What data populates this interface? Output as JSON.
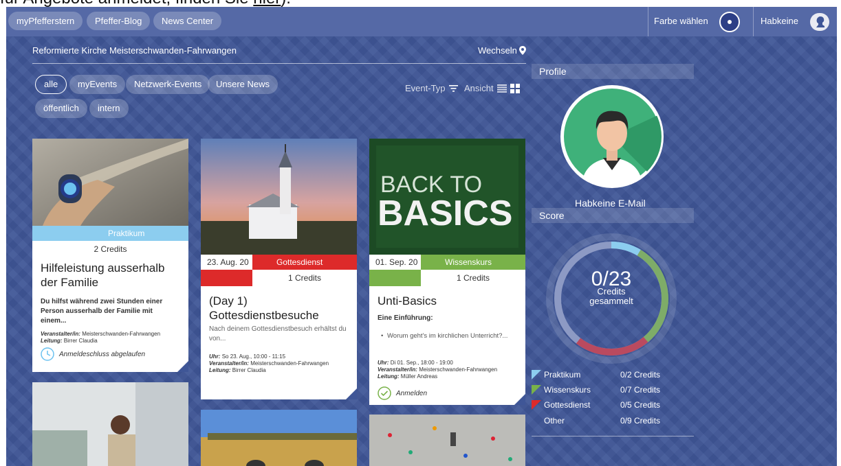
{
  "top_snippet": {
    "text": "für Angebote anmeldet, finden Sie ",
    "link": "hier",
    "end": ")."
  },
  "topbar": {
    "nav": [
      "myPfefferstern",
      "Pfeffer-Blog",
      "News Center"
    ],
    "color_label": "Farbe wählen",
    "user_name": "Habkeine"
  },
  "org": {
    "name": "Reformierte Kirche Meisterschwanden-Fahrwangen",
    "switch_label": "Wechseln"
  },
  "filters": {
    "row1": [
      "alle",
      "myEvents",
      "Netzwerk-Events",
      "Unsere News"
    ],
    "row2": [
      "öffentlich",
      "intern"
    ],
    "event_type_label": "Event-Typ",
    "view_label": "Ansicht"
  },
  "cards": [
    {
      "category": "Praktikum",
      "category_color": "#8ccdef",
      "credits": "2 Credits",
      "title": "Hilfeleistung ausserhalb der Familie",
      "desc": "Du hilfst während zwei Stunden einer Person ausserhalb der Familie mit einem...",
      "organizer_label": "Veranstalter/in:",
      "organizer": "Meisterschwanden-Fahrwangen",
      "leader_label": "Leitung:",
      "leader": "Birrer Claudia",
      "action": "Anmeldeschluss abgelaufen"
    },
    {
      "date": "23. Aug. 20",
      "category": "Gottesdienst",
      "category_color": "#dd2a2a",
      "credits": "1 Credits",
      "title": "(Day 1) Gottesdienstbesuche",
      "desc": "Nach deinem Gottesdienstbesuch erhältst du von...",
      "time_label": "Uhr:",
      "time": "So 23. Aug., 10:00 - 11:15",
      "organizer_label": "Veranstalter/in:",
      "organizer": "Meisterschwanden-Fahrwangen",
      "leader_label": "Leitung:",
      "leader": "Birrer Claudia"
    },
    {
      "date": "01. Sep. 20",
      "category": "Wissenskurs",
      "category_color": "#79b249",
      "credits": "1 Credits",
      "title": "Unti-Basics",
      "subtitle": "Eine Einführung:",
      "bullet": "Worum geht's im kirchlichen Unterricht?...",
      "time_label": "Uhr:",
      "time": "Di 01. Sep., 18:00 - 19:00",
      "organizer_label": "Veranstalter/in:",
      "organizer": "Meisterschwanden-Fahrwangen",
      "leader_label": "Leitung:",
      "leader": "Müller Andreas",
      "action": "Anmelden",
      "image_text_1": "BACK TO",
      "image_text_2": "BASICS"
    }
  ],
  "profile": {
    "heading": "Profile",
    "name": "Habkeine E-Mail"
  },
  "score": {
    "heading": "Score",
    "value": "0/23",
    "sub1": "Credits",
    "sub2": "gesammelt",
    "legend": [
      {
        "name": "Praktikum",
        "value": "0/2 Credits",
        "color": "#8ccdef"
      },
      {
        "name": "Wissenskurs",
        "value": "0/7 Credits",
        "color": "#79b249"
      },
      {
        "name": "Gottesdienst",
        "value": "0/5 Credits",
        "color": "#dd2a2a"
      },
      {
        "name": "Other",
        "value": "0/9 Credits",
        "color": ""
      }
    ]
  }
}
